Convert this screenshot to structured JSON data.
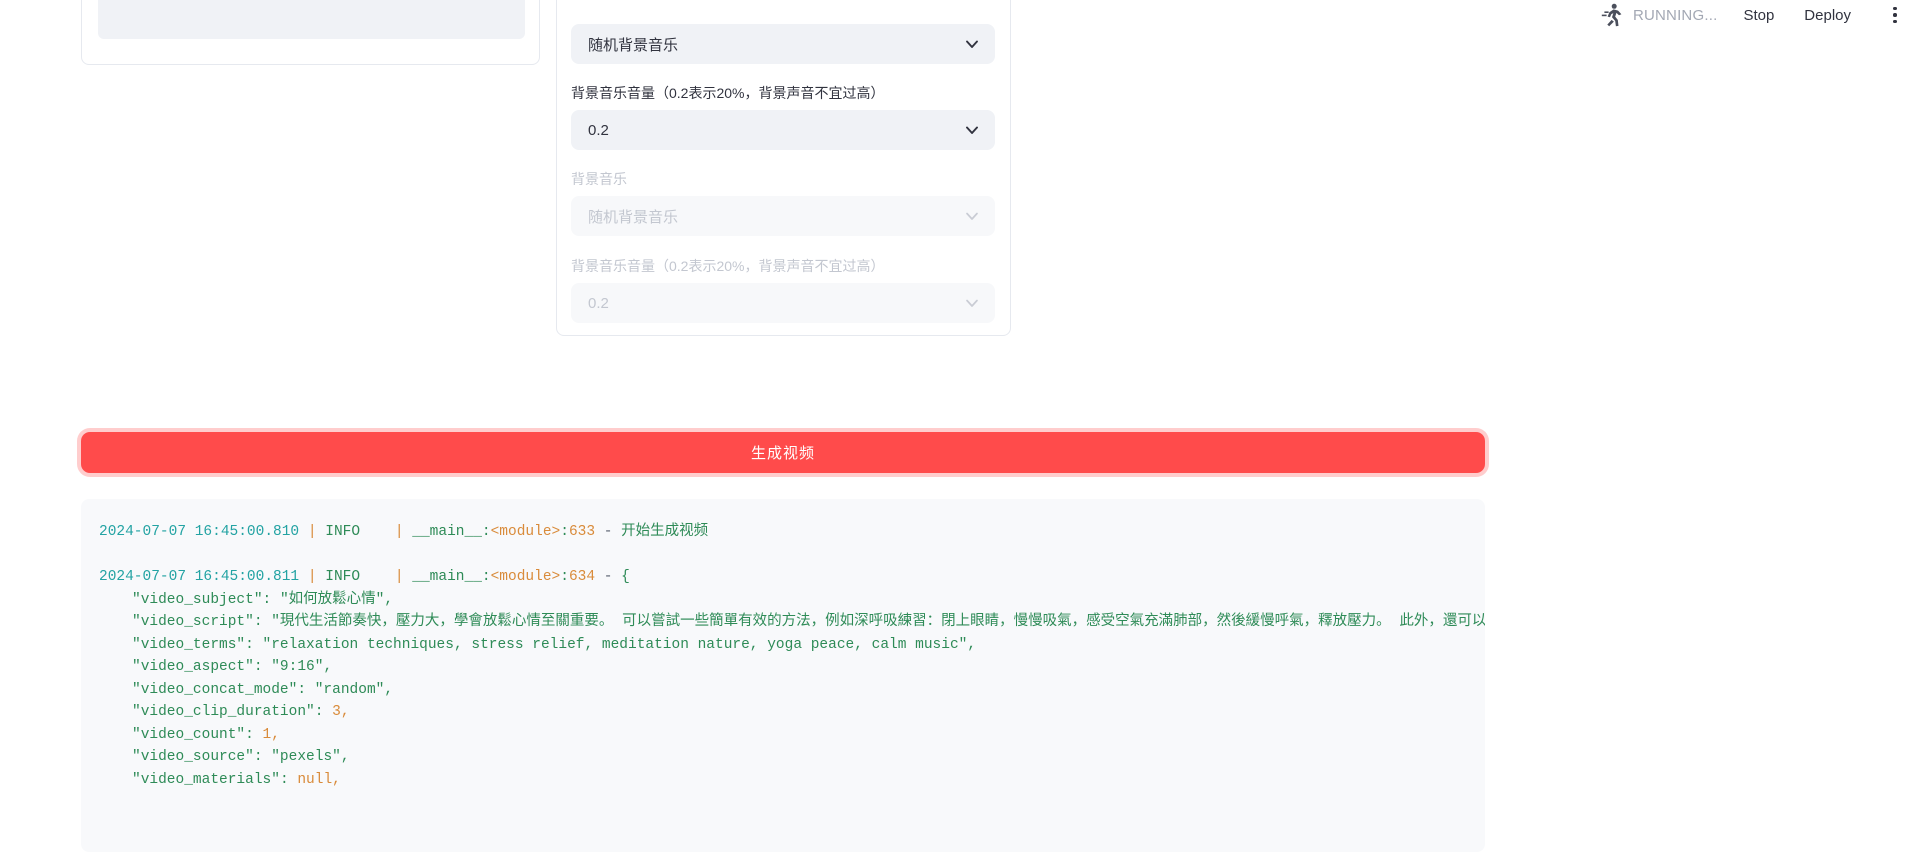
{
  "topbar": {
    "status": "RUNNING...",
    "stop_label": "Stop",
    "deploy_label": "Deploy",
    "runner_icon": "running-man-icon",
    "menu_icon": "kebab-menu-icon"
  },
  "left_panel": {
    "textarea_value": "",
    "resize_icon": "resize-grip-icon"
  },
  "form": {
    "bgm_select_enabled": {
      "value": "随机背景音乐",
      "chevron_icon": "chevron-down-icon"
    },
    "bgm_volume_enabled": {
      "label": "背景音乐音量（0.2表示20%，背景声音不宜过高）",
      "value": "0.2",
      "chevron_icon": "chevron-down-icon"
    },
    "bgm_select_disabled": {
      "label": "背景音乐",
      "value": "随机背景音乐",
      "chevron_icon": "chevron-down-icon"
    },
    "bgm_volume_disabled": {
      "label": "背景音乐音量（0.2表示20%，背景声音不宜过高）",
      "value": "0.2",
      "chevron_icon": "chevron-down-icon"
    }
  },
  "generate_button": {
    "label": "生成视频",
    "color": "#ff4b4b"
  },
  "log": {
    "lines": [
      {
        "type": "entry",
        "timestamp": "2024-07-07 16:45:00.810",
        "level": "INFO",
        "module": "__main__",
        "func": "<module>",
        "line_no": "633",
        "message": "开始生成视频"
      },
      {
        "type": "entry",
        "timestamp": "2024-07-07 16:45:00.811",
        "level": "INFO",
        "module": "__main__",
        "func": "<module>",
        "line_no": "634",
        "message": "{"
      },
      {
        "type": "json",
        "key": "\"video_subject\"",
        "value": "\"如何放鬆心情\",",
        "kind": "str"
      },
      {
        "type": "json",
        "key": "\"video_script\"",
        "value": "\"現代生活節奏快，壓力大，學會放鬆心情至關重要。 可以嘗試一些簡單有效的方法，例如深呼吸練習：閉上眼睛，慢慢吸氣，感受空氣充滿肺部，然後緩慢呼氣，釋放壓力。 此外，還可以進",
        "kind": "str"
      },
      {
        "type": "json",
        "key": "\"video_terms\"",
        "value": "\"relaxation techniques, stress relief, meditation nature, yoga peace, calm music\",",
        "kind": "str"
      },
      {
        "type": "json",
        "key": "\"video_aspect\"",
        "value": "\"9:16\",",
        "kind": "str"
      },
      {
        "type": "json",
        "key": "\"video_concat_mode\"",
        "value": "\"random\",",
        "kind": "str"
      },
      {
        "type": "json",
        "key": "\"video_clip_duration\"",
        "value": "3,",
        "kind": "num"
      },
      {
        "type": "json",
        "key": "\"video_count\"",
        "value": "1,",
        "kind": "num"
      },
      {
        "type": "json",
        "key": "\"video_source\"",
        "value": "\"pexels\",",
        "kind": "str"
      },
      {
        "type": "json",
        "key": "\"video_materials\"",
        "value": "null,",
        "kind": "null"
      }
    ]
  }
}
